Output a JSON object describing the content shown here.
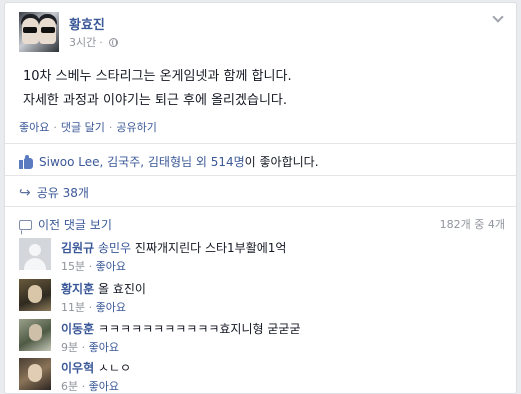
{
  "post": {
    "author": "황효진",
    "time": "3시간",
    "lines": [
      "10차 스베누 스타리그는 온게임넷과 함께 합니다.",
      "자세한 과정과 이야기는 퇴근 후에 올리겠습니다."
    ],
    "actions": {
      "like": "좋아요",
      "comment": "댓글 달기",
      "share": "공유하기",
      "separator": "·"
    }
  },
  "likes": {
    "names": "Siwoo Lee, 김국주, 김태형님 외 514명",
    "suffix": "이 좋아합니다."
  },
  "shares": {
    "label": "공유 38개"
  },
  "comments_header": {
    "prev_label": "이전 댓글 보기",
    "count": "182개 중 4개"
  },
  "comments": [
    {
      "name": "김원규",
      "tag": "송민우",
      "text": "진짜개지린다 스타1부활에1억",
      "time": "15분",
      "like": "좋아요"
    },
    {
      "name": "황지훈",
      "tag": "",
      "text": "올 효진이",
      "time": "11분",
      "like": "좋아요"
    },
    {
      "name": "이동훈",
      "tag": "",
      "text": "ㅋㅋㅋㅋㅋㅋㅋㅋㅋㅋㅋ효지니형 굳굳굳",
      "time": "9분",
      "like": "좋아요"
    },
    {
      "name": "이우혁",
      "tag": "",
      "text": "ㅅㄴㅇ",
      "time": "6분",
      "like": "좋아요"
    }
  ],
  "icons": {
    "chevron": "chevron-down-icon",
    "globe": "globe-icon",
    "like": "thumbs-up-icon",
    "share": "share-arrow-icon",
    "comment": "comment-bubble-icon"
  },
  "colors": {
    "link": "#3b5998",
    "muted": "#90949c",
    "background": "#e9ebee"
  }
}
